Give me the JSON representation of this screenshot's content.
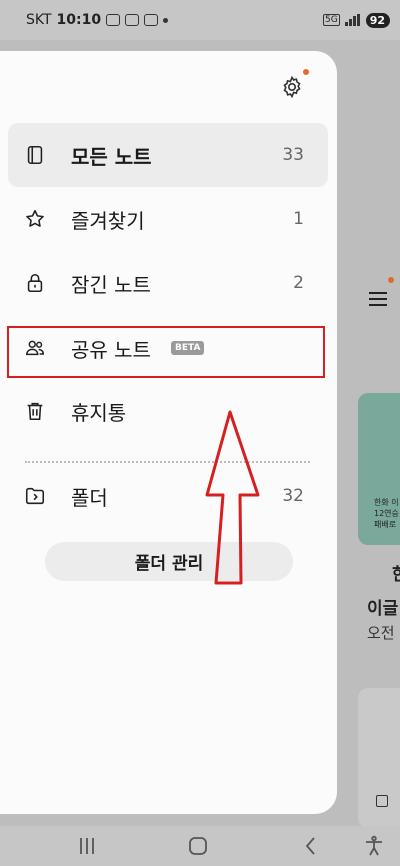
{
  "status_bar": {
    "carrier": "SKT",
    "time": "10:10",
    "network": "5G",
    "battery": "92"
  },
  "drawer": {
    "items": [
      {
        "label": "모든 노트",
        "count": "33",
        "icon": "notebook-icon"
      },
      {
        "label": "즐겨찾기",
        "count": "1",
        "icon": "star-icon"
      },
      {
        "label": "잠긴 노트",
        "count": "2",
        "icon": "lock-icon"
      },
      {
        "label": "공유 노트",
        "badge": "BETA",
        "icon": "people-icon"
      },
      {
        "label": "휴지통",
        "icon": "trash-icon"
      },
      {
        "label": "폴더",
        "count": "32",
        "icon": "folder-icon"
      }
    ],
    "folder_manage_label": "폴더 관리"
  },
  "background": {
    "card_text_lines": [
      "한화 이",
      "12연승",
      "패배로"
    ],
    "snippet1": "한",
    "snippet2": "이글",
    "snippet3": "오전"
  },
  "colors": {
    "accent_dot": "#e06a2f",
    "highlight": "#d62020",
    "card": "#7aa89a"
  }
}
